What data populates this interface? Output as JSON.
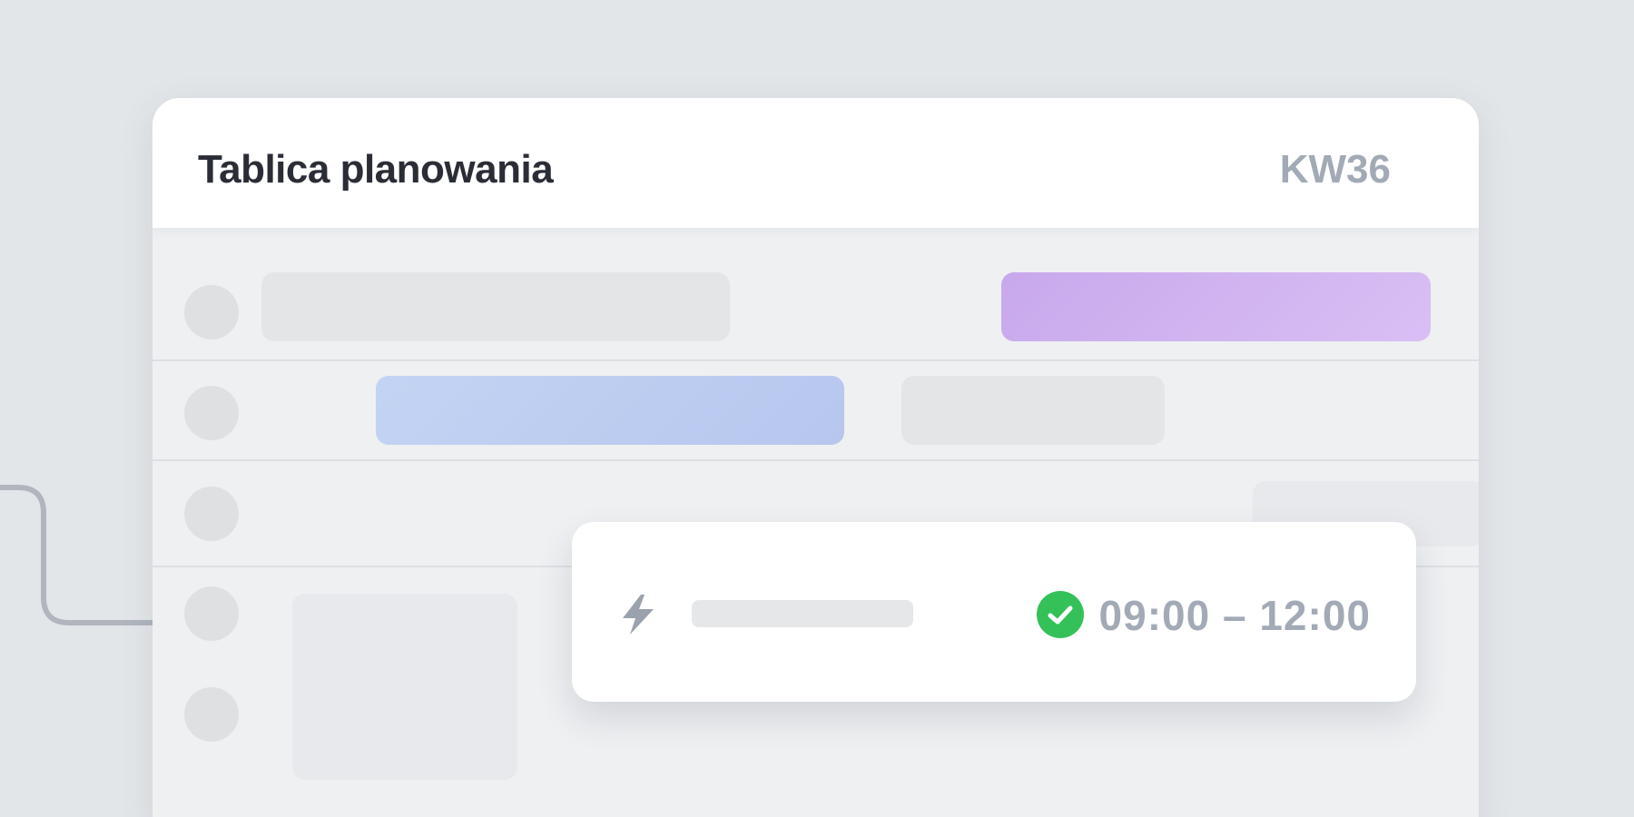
{
  "board": {
    "title": "Tablica planowania",
    "week": "KW36"
  },
  "task_card": {
    "time_range": "09:00 – 12:00",
    "status": "confirmed",
    "icons": [
      "bolt-icon",
      "check-circle-icon"
    ]
  },
  "colors": {
    "accent_purple": "#c8a8ec",
    "accent_blue": "#bccbf0",
    "success_green": "#34c159",
    "muted_text": "#a2aab5",
    "title_text": "#2b2d36"
  }
}
